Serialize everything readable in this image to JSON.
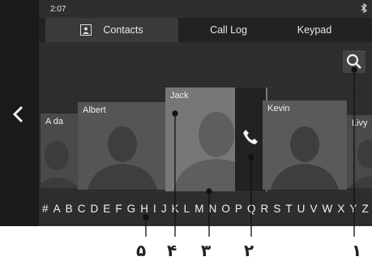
{
  "status": {
    "time": "2:07",
    "bluetooth_icon": "bluetooth-icon"
  },
  "tabs": [
    {
      "label": "Contacts",
      "icon": "contact-card-icon",
      "active": true
    },
    {
      "label": "Call Log",
      "active": false
    },
    {
      "label": "Keypad",
      "active": false
    }
  ],
  "contacts": [
    {
      "name": "A da"
    },
    {
      "name": "Albert"
    },
    {
      "name": "Jack"
    },
    {
      "name": "Kevin"
    },
    {
      "name": "Livy"
    }
  ],
  "alphabet": [
    "#",
    "A",
    "B",
    "C",
    "D",
    "E",
    "F",
    "G",
    "H",
    "I",
    "J",
    "K",
    "L",
    "M",
    "N",
    "O",
    "P",
    "Q",
    "R",
    "S",
    "T",
    "U",
    "V",
    "W",
    "X",
    "Y",
    "Z"
  ],
  "callouts": [
    "۵",
    "۴",
    "۳",
    "۲",
    "۱"
  ],
  "colors": {
    "background": "#2b2b2b",
    "text": "#f0f0f0"
  }
}
